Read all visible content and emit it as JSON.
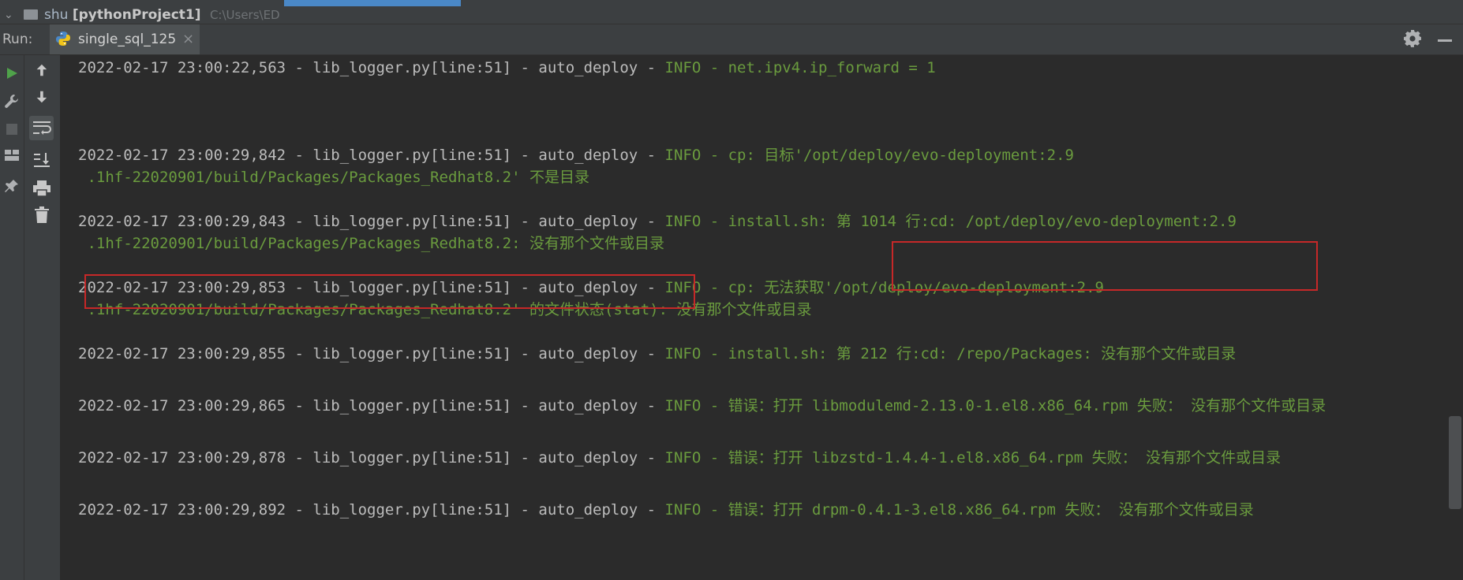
{
  "topbar": {
    "project_name": "shu",
    "project_bracket": "[pythonProject1]",
    "project_path": "C:\\Users\\ED"
  },
  "run": {
    "label": "Run:",
    "tab_label": "single_sql_125",
    "close_glyph": "×"
  },
  "icons": {
    "toolbar_left": [
      "play-icon",
      "wrench-icon",
      "stop-icon",
      "layout-icon",
      "pin-icon"
    ],
    "toolbar_right": [
      "arrow-up-icon",
      "arrow-down-icon",
      "soft-wrap-icon",
      "scroll-to-end-icon",
      "print-icon",
      "trash-icon"
    ],
    "header": [
      "python-icon",
      "close-icon",
      "gear-icon",
      "minimize-icon"
    ]
  },
  "colors": {
    "background": "#2b2b2b",
    "log_white": "#bcbcbc",
    "log_green": "#6a9b3e",
    "highlight_red": "#c62828",
    "run_green": "#4fa24a"
  },
  "console": {
    "lines": [
      {
        "w": "2022-02-17 23:00:22,563 - lib_logger.py[line:51] - auto_deploy - ",
        "g": "INFO - net.ipv4.ip_forward = 1"
      },
      {
        "w": "2022-02-17 23:00:29,842 - lib_logger.py[line:51] - auto_deploy - ",
        "g": "INFO - cp: 目标'/opt/deploy/evo-deployment:2.9"
      },
      {
        "w": "",
        "g": " .1hf-22020901/build/Packages/Packages_Redhat8.2' 不是目录"
      },
      {
        "w": "2022-02-17 23:00:29,843 - lib_logger.py[line:51] - auto_deploy - ",
        "g": "INFO - install.sh: 第 1014 行:cd: /opt/deploy/evo-deployment:2.9"
      },
      {
        "w": "",
        "g": " .1hf-22020901/build/Packages/Packages_Redhat8.2: 没有那个文件或目录"
      },
      {
        "w": "2022-02-17 23:00:29,853 - lib_logger.py[line:51] - auto_deploy - ",
        "g": "INFO - cp: 无法获取'/opt/deploy/evo-deployment:2.9"
      },
      {
        "w": "",
        "g": " .1hf-22020901/build/Packages/Packages_Redhat8.2' 的文件状态(stat): 没有那个文件或目录"
      },
      {
        "w": "2022-02-17 23:00:29,855 - lib_logger.py[line:51] - auto_deploy - ",
        "g": "INFO - install.sh: 第 212 行:cd: /repo/Packages: 没有那个文件或目录"
      },
      {
        "w": "2022-02-17 23:00:29,865 - lib_logger.py[line:51] - auto_deploy - ",
        "g": "INFO - 错误：打开 libmodulemd-2.13.0-1.el8.x86_64.rpm 失败： 没有那个文件或目录"
      },
      {
        "w": "2022-02-17 23:00:29,878 - lib_logger.py[line:51] - auto_deploy - ",
        "g": "INFO - 错误：打开 libzstd-1.4.4-1.el8.x86_64.rpm 失败： 没有那个文件或目录"
      },
      {
        "w": "2022-02-17 23:00:29,892 - lib_logger.py[line:51] - auto_deploy - ",
        "g": "INFO - 错误：打开 drpm-0.4.1-3.el8.x86_64.rpm 失败： 没有那个文件或目录"
      }
    ]
  }
}
